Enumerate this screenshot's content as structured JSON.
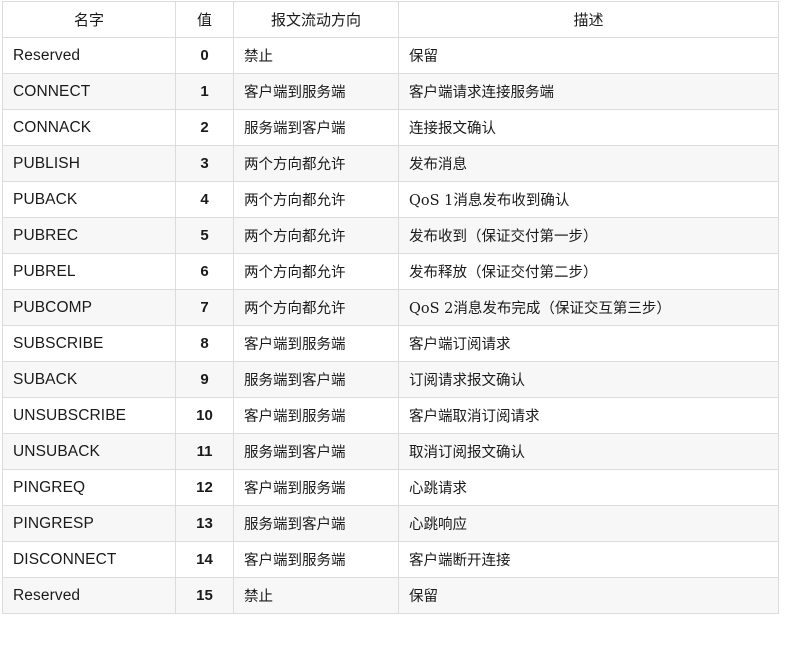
{
  "table": {
    "headers": {
      "name": "名字",
      "value": "值",
      "direction": "报文流动方向",
      "description": "描述"
    },
    "rows": [
      {
        "name": "Reserved",
        "value": "0",
        "direction": "禁止",
        "description": "保留"
      },
      {
        "name": "CONNECT",
        "value": "1",
        "direction": "客户端到服务端",
        "description": "客户端请求连接服务端"
      },
      {
        "name": "CONNACK",
        "value": "2",
        "direction": "服务端到客户端",
        "description": "连接报文确认"
      },
      {
        "name": "PUBLISH",
        "value": "3",
        "direction": "两个方向都允许",
        "description": "发布消息"
      },
      {
        "name": "PUBACK",
        "value": "4",
        "direction": "两个方向都允许",
        "description": "QoS 1消息发布收到确认"
      },
      {
        "name": "PUBREC",
        "value": "5",
        "direction": "两个方向都允许",
        "description": "发布收到（保证交付第一步）"
      },
      {
        "name": "PUBREL",
        "value": "6",
        "direction": "两个方向都允许",
        "description": "发布释放（保证交付第二步）"
      },
      {
        "name": "PUBCOMP",
        "value": "7",
        "direction": "两个方向都允许",
        "description": "QoS 2消息发布完成（保证交互第三步）"
      },
      {
        "name": "SUBSCRIBE",
        "value": "8",
        "direction": "客户端到服务端",
        "description": "客户端订阅请求"
      },
      {
        "name": "SUBACK",
        "value": "9",
        "direction": "服务端到客户端",
        "description": "订阅请求报文确认"
      },
      {
        "name": "UNSUBSCRIBE",
        "value": "10",
        "direction": "客户端到服务端",
        "description": "客户端取消订阅请求"
      },
      {
        "name": "UNSUBACK",
        "value": "11",
        "direction": "服务端到客户端",
        "description": "取消订阅报文确认"
      },
      {
        "name": "PINGREQ",
        "value": "12",
        "direction": "客户端到服务端",
        "description": "心跳请求"
      },
      {
        "name": "PINGRESP",
        "value": "13",
        "direction": "服务端到客户端",
        "description": "心跳响应"
      },
      {
        "name": "DISCONNECT",
        "value": "14",
        "direction": "客户端到服务端",
        "description": "客户端断开连接"
      },
      {
        "name": "Reserved",
        "value": "15",
        "direction": "禁止",
        "description": "保留"
      }
    ]
  },
  "colors": {
    "border": "#dcdcdc",
    "row_even_bg": "#f7f7f7",
    "row_odd_bg": "#ffffff",
    "text": "#1a1a1a"
  }
}
